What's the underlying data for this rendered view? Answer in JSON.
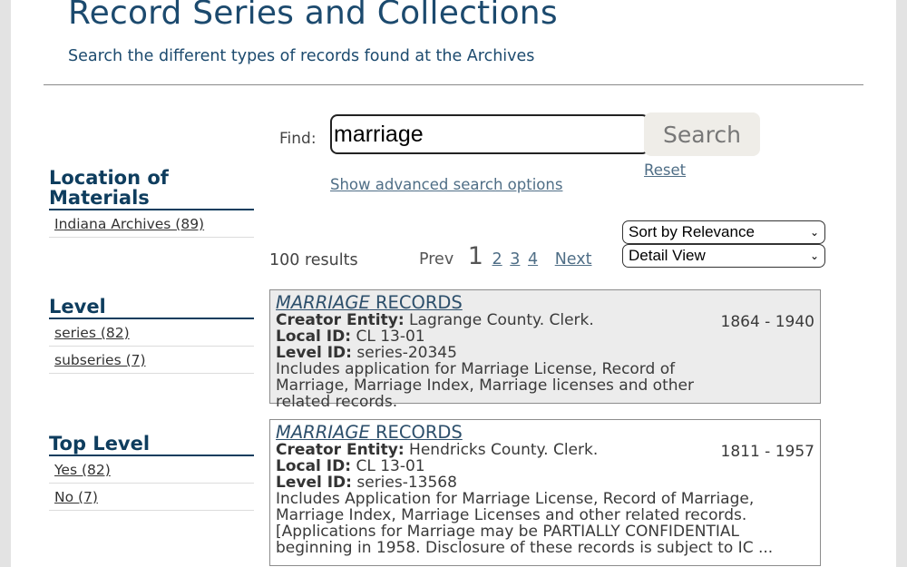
{
  "header": {
    "title": "Record Series and Collections",
    "subtitle": "Search the different types of records found at the Archives"
  },
  "search": {
    "find_label": "Find:",
    "query": "marriage",
    "search_label": "Search",
    "reset_label": "Reset",
    "advanced_label": "Show advanced search options"
  },
  "facets": [
    {
      "title": "Location of Materials",
      "items": [
        "Indiana Archives (89)"
      ]
    },
    {
      "title": "Level",
      "items": [
        "series (82)",
        "subseries (7)"
      ]
    },
    {
      "title": "Top Level",
      "items": [
        "Yes (82)",
        "No (7)"
      ]
    }
  ],
  "results_bar": {
    "count": "100 results",
    "prev": "Prev",
    "current_page": "1",
    "pages": [
      "2",
      "3",
      "4"
    ],
    "next": "Next",
    "sort_selected": "Sort by Relevance",
    "view_selected": "Detail View"
  },
  "results": [
    {
      "title_em": "MARRIAGE",
      "title_rest": " RECORDS",
      "dates": "1864 - 1940",
      "creator_label": "Creator Entity:",
      "creator": " Lagrange County. Clerk.",
      "local_label": "Local ID:",
      "local_id": " CL 13-01",
      "level_label": "Level ID:",
      "level_id": " series-20345",
      "description": "Includes application for Marriage License, Record of Marriage, Marriage Index, Marriage licenses and other related records."
    },
    {
      "title_em": "MARRIAGE",
      "title_rest": " RECORDS",
      "dates": "1811 - 1957",
      "creator_label": "Creator Entity:",
      "creator": " Hendricks County. Clerk.",
      "local_label": "Local ID:",
      "local_id": " CL 13-01",
      "level_label": "Level ID:",
      "level_id": " series-13568",
      "description": "Includes Application for Marriage License, Record of Marriage, Marriage Index, Marriage Licenses and other related records. [Applications for Marriage may be PARTIALLY CONFIDENTIAL beginning in 1958. Disclosure of these records is subject to IC ..."
    }
  ]
}
